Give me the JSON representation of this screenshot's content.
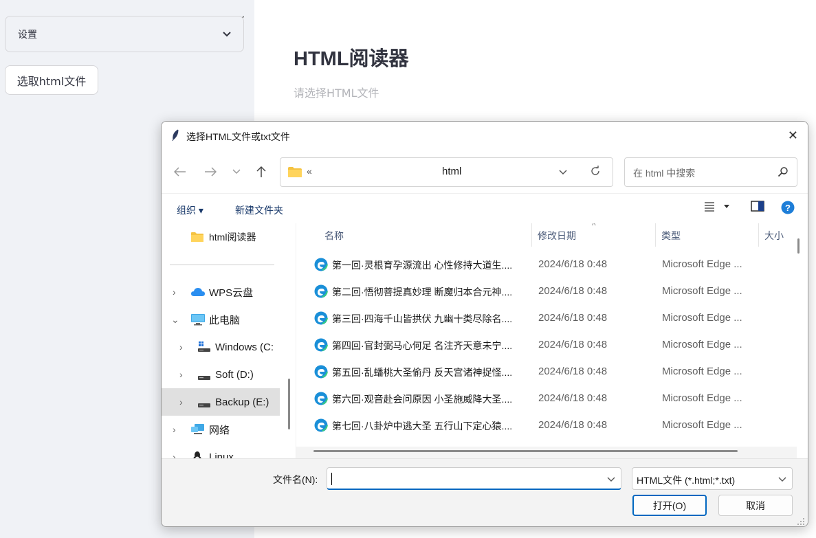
{
  "sidebar": {
    "close_glyph": "×",
    "expander_label": "设置",
    "pick_button_label": "选取html文件"
  },
  "main": {
    "title": "HTML阅读器",
    "subtitle": "请选择HTML文件"
  },
  "dialog": {
    "title": "选择HTML文件或txt文件",
    "close_glyph": "✕",
    "address": {
      "overflow_chevron": "«",
      "path": "html"
    },
    "search_placeholder": "在 html 中搜索",
    "commands": {
      "organize": "组织 ▾",
      "new_folder": "新建文件夹"
    },
    "nav_pane": [
      {
        "label": "html阅读器",
        "icon": "folder-icon",
        "expandable": false
      },
      {
        "label": "WPS云盘",
        "icon": "cloud-icon",
        "expandable": true,
        "expanded": false
      },
      {
        "label": "此电脑",
        "icon": "computer-icon",
        "expandable": true,
        "expanded": true
      },
      {
        "label": "Windows  (C:",
        "icon": "windows-drive-icon",
        "expandable": true,
        "expanded": false
      },
      {
        "label": "Soft (D:)",
        "icon": "drive-icon",
        "expandable": true,
        "expanded": false
      },
      {
        "label": "Backup (E:)",
        "icon": "drive-icon",
        "expandable": true,
        "expanded": false,
        "selected": true
      },
      {
        "label": "网络",
        "icon": "network-icon",
        "expandable": true,
        "expanded": false
      },
      {
        "label": "Linux",
        "icon": "linux-icon",
        "expandable": true,
        "expanded": false
      }
    ],
    "columns": [
      "名称",
      "修改日期",
      "类型",
      "大小"
    ],
    "files": [
      {
        "name": "第一回·灵根育孕源流出 心性修持大道生....",
        "date": "2024/6/18 0:48",
        "type": "Microsoft Edge ..."
      },
      {
        "name": "第二回·悟彻菩提真妙理 断魔归本合元神....",
        "date": "2024/6/18 0:48",
        "type": "Microsoft Edge ..."
      },
      {
        "name": "第三回·四海千山皆拱伏 九幽十类尽除名....",
        "date": "2024/6/18 0:48",
        "type": "Microsoft Edge ..."
      },
      {
        "name": "第四回·官封弼马心何足 名注齐天意未宁....",
        "date": "2024/6/18 0:48",
        "type": "Microsoft Edge ..."
      },
      {
        "name": "第五回·乱蟠桃大圣偷丹 反天宫诸神捉怪....",
        "date": "2024/6/18 0:48",
        "type": "Microsoft Edge ..."
      },
      {
        "name": "第六回·观音赴会问原因 小圣施威降大圣....",
        "date": "2024/6/18 0:48",
        "type": "Microsoft Edge ..."
      },
      {
        "name": "第七回·八卦炉中逃大圣 五行山下定心猿....",
        "date": "2024/6/18 0:48",
        "type": "Microsoft Edge ..."
      }
    ],
    "filename_label": "文件名(N):",
    "filename_value": "",
    "filetype_value": "HTML文件 (*.html;*.txt)",
    "open_label": "打开(O)",
    "cancel_label": "取消"
  }
}
